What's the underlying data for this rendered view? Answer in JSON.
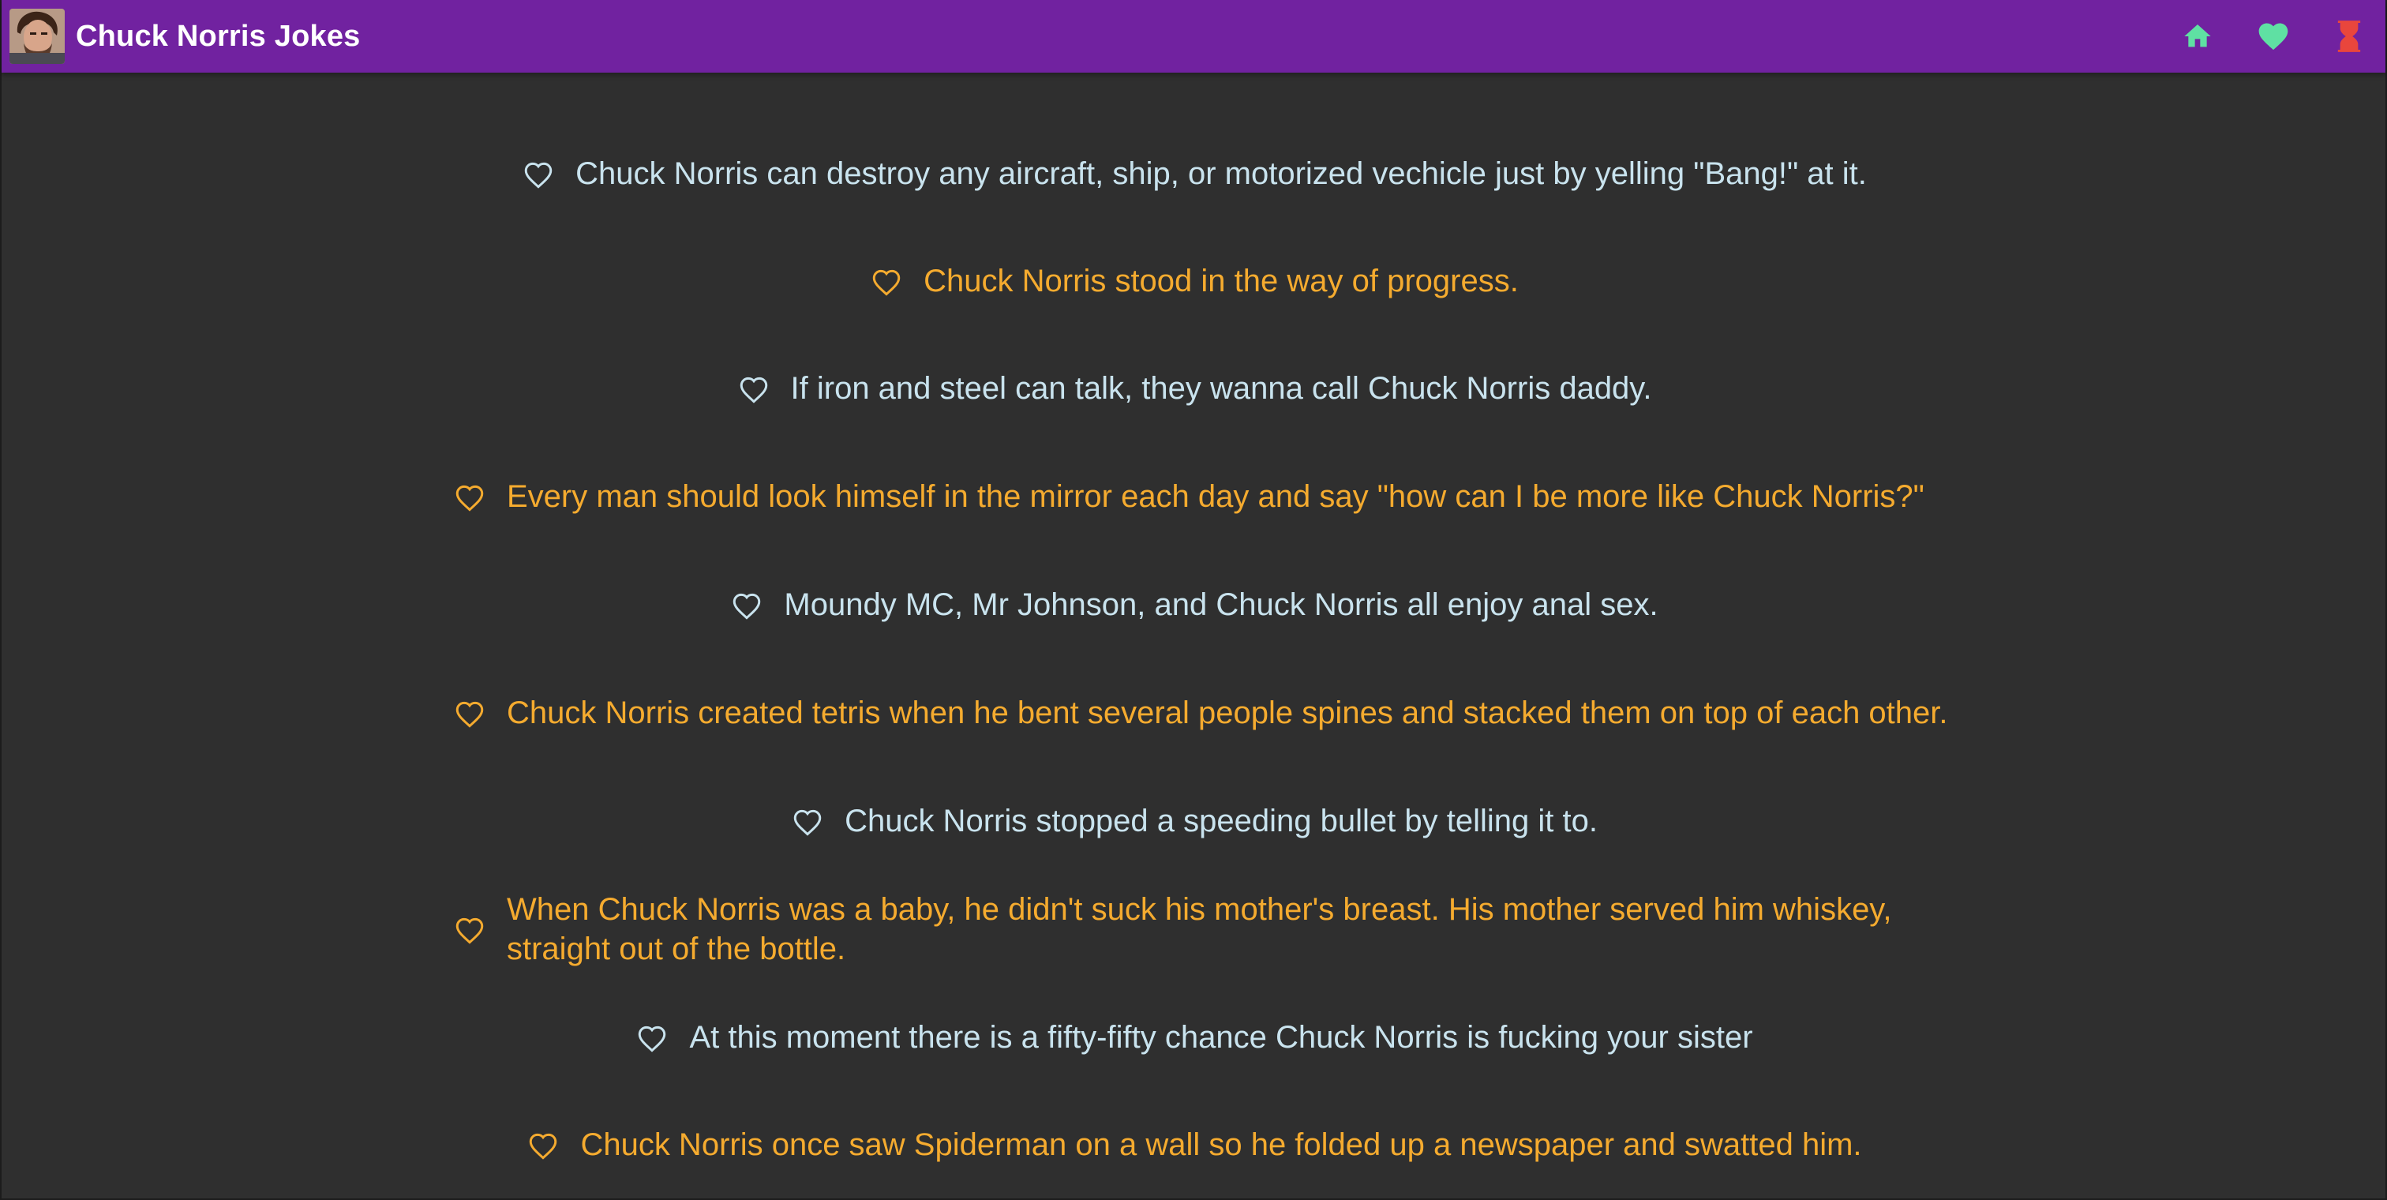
{
  "app": {
    "title": "Chuck Norris Jokes",
    "avatar": "chuck-norris-portrait"
  },
  "nav": {
    "items": [
      {
        "icon": "home-icon",
        "color": "#5fe0a3"
      },
      {
        "icon": "heart-filled-icon",
        "color": "#5fe0a3"
      },
      {
        "icon": "hourglass-icon",
        "color": "#e9463c"
      }
    ]
  },
  "colors": {
    "topbar": "#7122a0",
    "background": "#2f2f2f",
    "joke_even": "#c9e3ee",
    "joke_odd": "#f5ab2f"
  },
  "jokes": [
    {
      "text": "Chuck Norris can destroy any aircraft, ship, or motorized vechicle just by yelling \"Bang!\" at it."
    },
    {
      "text": "Chuck Norris stood in the way of progress."
    },
    {
      "text": "If iron and steel can talk, they wanna call Chuck Norris daddy."
    },
    {
      "text": "Every man should look himself in the mirror each day and say \"how can I be more like Chuck Norris?\""
    },
    {
      "text": "Moundy MC, Mr Johnson, and Chuck Norris all enjoy anal sex."
    },
    {
      "text": "Chuck Norris created tetris when he bent several people spines and stacked them on top of each other."
    },
    {
      "text": "Chuck Norris stopped a speeding bullet by telling it to."
    },
    {
      "text": "When Chuck Norris was a baby, he didn't suck his mother's breast. His mother served him whiskey, straight out of the bottle."
    },
    {
      "text": "At this moment there is a fifty-fifty chance Chuck Norris is fucking your sister"
    },
    {
      "text": "Chuck Norris once saw Spiderman on a wall so he folded up a newspaper and swatted him."
    }
  ]
}
